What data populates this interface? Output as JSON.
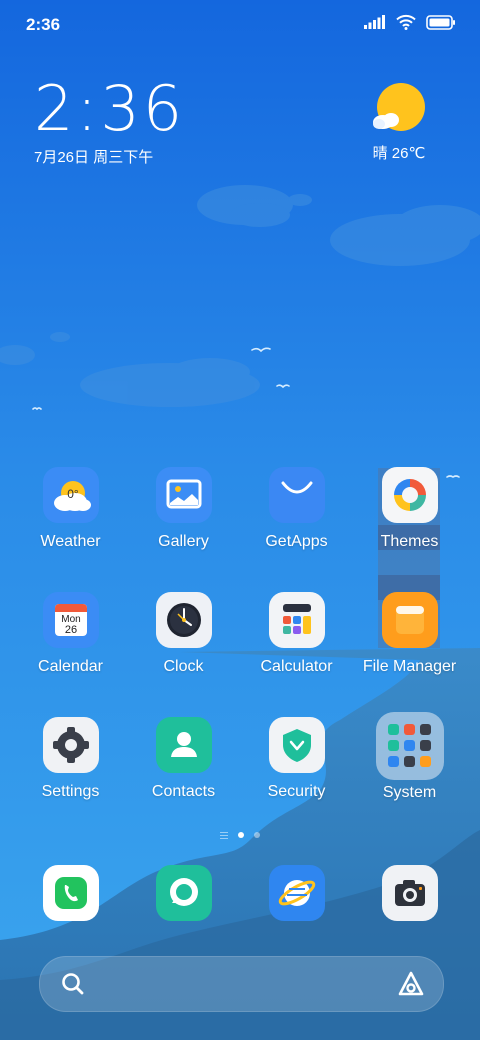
{
  "status_bar": {
    "time": "2:36",
    "icons": [
      "signal-icon",
      "wifi-icon",
      "battery-icon"
    ]
  },
  "clock_widget": {
    "time": "2:36",
    "date": "7月26日 周三下午"
  },
  "weather_widget": {
    "icon": "sunny-cloud-icon",
    "condition_temp": "晴 26℃"
  },
  "apps": [
    {
      "label": "Weather",
      "icon": "weather-icon",
      "badge": "0°"
    },
    {
      "label": "Gallery",
      "icon": "gallery-icon"
    },
    {
      "label": "GetApps",
      "icon": "getapps-icon"
    },
    {
      "label": "Themes",
      "icon": "themes-icon"
    },
    {
      "label": "Calendar",
      "icon": "calendar-icon",
      "month": "Mon",
      "day": "26"
    },
    {
      "label": "Clock",
      "icon": "clock-icon"
    },
    {
      "label": "Calculator",
      "icon": "calculator-icon"
    },
    {
      "label": "File Manager",
      "icon": "file-manager-icon"
    },
    {
      "label": "Settings",
      "icon": "settings-icon"
    },
    {
      "label": "Contacts",
      "icon": "contacts-icon"
    },
    {
      "label": "Security",
      "icon": "security-icon"
    },
    {
      "label": "System",
      "icon": "system-folder-icon"
    }
  ],
  "page_indicator": {
    "pages": 2,
    "active": 1
  },
  "dock": [
    {
      "icon": "phone-icon"
    },
    {
      "icon": "messaging-icon"
    },
    {
      "icon": "browser-icon"
    },
    {
      "icon": "camera-icon"
    }
  ],
  "search": {
    "icons": [
      "search-icon",
      "assistant-icon"
    ]
  },
  "colors": {
    "sky_top": "#1570e0",
    "sky_bottom": "#3aa7ee",
    "sea": "#2f78b5",
    "sun": "#ffc31d"
  }
}
